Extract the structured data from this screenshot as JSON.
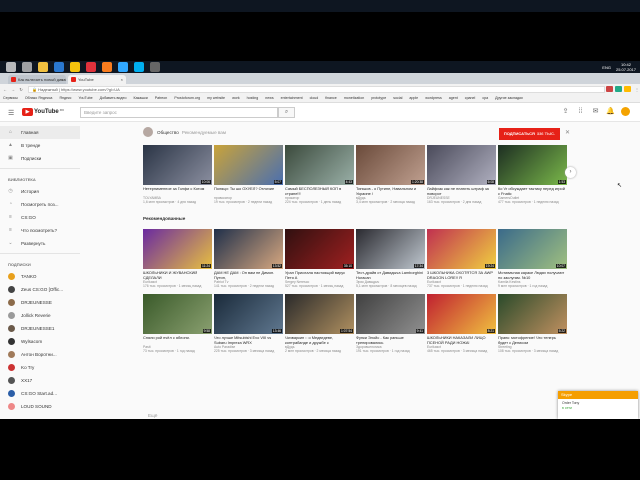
{
  "colors": {
    "accent": "#e62117",
    "skype": "#f59e00",
    "taskbar": "#0e1621"
  },
  "taskbar": {
    "icons": [
      "windows-icon",
      "search-icon",
      "file-explorer-icon",
      "edge-icon",
      "chrome-icon",
      "opera-icon",
      "firefox-icon",
      "photoshop-icon",
      "skype-icon",
      "obs-icon"
    ],
    "lang": "ENG",
    "time": "10:42",
    "date": "25.07.2017"
  },
  "tabs": [
    {
      "label": "Как включить новый дизайн",
      "favicon": "#e62117",
      "active": false
    },
    {
      "label": "YouTube",
      "favicon": "#e62117",
      "active": true
    }
  ],
  "address": {
    "secure": "Надежный",
    "url": "https://www.youtube.com/?gl=UA"
  },
  "bookmarks": [
    "Сервисы",
    "Облако Яндекса",
    "Яндекс",
    "YouTube",
    "Добавить видео",
    "Какашки",
    "Patreon",
    "Prostoforum.org",
    "my website",
    "work",
    "hosting",
    "news",
    "entertainment",
    "cloud",
    "finance",
    "monetization",
    "prototype",
    "social",
    "apple",
    "wordpress",
    "agent",
    "cpanel",
    "cpa",
    "Другие закладки"
  ],
  "header": {
    "logo": "YouTube",
    "region": "RU",
    "search_placeholder": "Введите запрос"
  },
  "sidebar": {
    "main": [
      {
        "label": "Главная",
        "icon": "home-icon"
      },
      {
        "label": "В тренде",
        "icon": "trending-icon"
      },
      {
        "label": "Подписки",
        "icon": "subscriptions-icon"
      }
    ],
    "library_title": "БИБЛИОТЕКА",
    "library": [
      {
        "label": "История",
        "icon": "history-icon"
      },
      {
        "label": "Посмотреть поз...",
        "icon": "clock-icon"
      },
      {
        "label": "CS:GO",
        "icon": "playlist-icon"
      },
      {
        "label": "Что посмотреть?",
        "icon": "playlist-icon"
      },
      {
        "label": "Развернуть",
        "icon": "chevron-down-icon"
      }
    ],
    "subs_title": "ПОДПИСКИ",
    "subs": [
      {
        "label": "TANKO",
        "color": "#e8a01c"
      },
      {
        "label": "Zeus CS:GO [Offic...",
        "color": "#444"
      },
      {
        "label": "DRJEUNESSE",
        "color": "#8c6b4a"
      },
      {
        "label": "Jollick Reverie",
        "color": "#9a9a9a"
      },
      {
        "label": "DRJEUNESSE1",
        "color": "#6b5a4a"
      },
      {
        "label": "Wylsacom",
        "color": "#333"
      },
      {
        "label": "Антон Воротни...",
        "color": "#a07a5a"
      },
      {
        "label": "Ko Try",
        "color": "#c33"
      },
      {
        "label": "XX17",
        "color": "#555"
      },
      {
        "label": "CS:GO Start.ad...",
        "color": "#2b5ea7"
      },
      {
        "label": "LOUD SOUND",
        "color": "#e88"
      }
    ]
  },
  "shelf1": {
    "channel": "Общество",
    "sub": "Рекомендуемые вам",
    "subscribe": "ПОДПИСАТЬСЯ",
    "sub_count": "336 ТЫС."
  },
  "shelf2": {
    "title": "Рекомендованные"
  },
  "shelf3": {
    "title": "Ещё"
  },
  "row1": [
    {
      "title": "Нетерпименное за Голфи с Котом",
      "channel": "TOLYAMBA",
      "meta": "1,6 млн просмотров · 4 дня назад",
      "dur": "10:06",
      "c1": "#2a3445",
      "c2": "#8b8fa0"
    },
    {
      "title": "Поляци: Ты шо ОХУЕЛ? Отличие",
      "channel": "провокатор",
      "meta": "19 тыс. просмотров · 2 недели назад",
      "dur": "5:07",
      "c1": "#c9a33a",
      "c2": "#4a6fb0"
    },
    {
      "title": "Самый БЕСПОЛЕЗНЫЙ КОП в стране!!!",
      "channel": "прокатор",
      "meta": "224 тыс. просмотров · 1 день назад",
      "dur": "4:43",
      "c1": "#3b4a3c",
      "c2": "#9ab0a8"
    },
    {
      "title": "Тиньков - о Путине, Навальном и Украине /",
      "channel": "вДудь",
      "meta": "3,4 млн просмотров · 2 месяца назад",
      "dur": "1:20:38",
      "c1": "#6a4a3a",
      "c2": "#c0a090"
    },
    {
      "title": "Лайфхак как не платить штраф за поворот",
      "channel": "DRJEUNESSE",
      "meta": "163 тыс. просмотров · 2 дня назад",
      "dur": "6:08",
      "c1": "#4a4a5a",
      "c2": "#b0b0c0"
    },
    {
      "title": "Ко Vr обсуждает тактику перед игрой с Fnatic",
      "channel": "GamersOutlet",
      "meta": "477 тыс. просмотров · 1 неделю назад",
      "dur": "1:53",
      "c1": "#1d2e22",
      "c2": "#7ab84a"
    }
  ],
  "row2": [
    {
      "title": "ШКОЛЬНИКИ И ЖУВАНСКИЙ СДЕЛАЛИ",
      "channel": "Eurikasxt",
      "meta": "176 тыс. просмотров · 1 месяц назад",
      "dur": "11:24",
      "c1": "#6a2aa0",
      "c2": "#e8c040"
    },
    {
      "title": "ДАМ НЕ ДАМ : Он вам не Димон. Путин,",
      "channel": "Patriot Tv",
      "meta": "141 тыс. просмотров · 2 недели назад",
      "dur": "13:52",
      "c1": "#20304a",
      "c2": "#d8a880"
    },
    {
      "title": "Урал Прислала настоящий вирус Петя А",
      "channel": "Sergey Neresco",
      "meta": "527 тыс. просмотров · 1 месяц назад",
      "dur": "35:10",
      "c1": "#301010",
      "c2": "#a02020"
    },
    {
      "title": "Тест-драйв от Давидыча Lamborghini Huracan",
      "channel": "Эрик Давыдыч",
      "meta": "5,1 млн просмотров · 8 месяцев назад",
      "dur": "17:34",
      "c1": "#2a2a30",
      "c2": "#c0c8d0"
    },
    {
      "title": "3 ШКОЛЬНИКА ОХОТЯТСЯ ЗА AWP DRAGON LORE!! Я",
      "channel": "Eurikasxt",
      "meta": "737 тыс. просмотров · 1 неделю назад",
      "dur": "19:24",
      "c1": "#c03050",
      "c2": "#f0d040"
    },
    {
      "title": "Мотивачная караке Людях получают по заслугам. №10",
      "channel": "Kamila Kestins",
      "meta": "9 млн просмотров · 1 год назад",
      "dur": "10:07",
      "c1": "#3a6a8a",
      "c2": "#a0c080"
    }
  ],
  "row3": [
    {
      "title": "Сняли рой пчёл с яблони.",
      "channel": "Pasit",
      "meta": "73 тыс. просмотров · 1 год назад",
      "dur": "9:58",
      "c1": "#3a5a2a",
      "c2": "#8aa070"
    },
    {
      "title": "Что лучше Mitsubishi Evo VIII vs Subaru Impreza WRX",
      "channel": "Auto Paradise",
      "meta": "225 тыс. просмотров · 3 месяца назад",
      "dur": "13:46",
      "c1": "#1a2a3a",
      "c2": "#607890"
    },
    {
      "title": "Чичваркин :: о Медведеве, контрабанде и дружбе с",
      "channel": "вДудь",
      "meta": "2 млн просмотров · 2 месяца назад",
      "dur": "1:07:54",
      "c1": "#2a2a2a",
      "c2": "#b09060"
    },
    {
      "title": "Функи Элойс - Как раньше тренировались",
      "channel": "Здоровьелогика",
      "meta": "191 тыс. просмотров · 1 год назад",
      "dur": "9:41",
      "c1": "#404040",
      "c2": "#909090"
    },
    {
      "title": "ШКОЛЬНИКИ НАКАЗАЛИ ЛИЦО ПСЕНОЙ РАДИ НОЖА!",
      "channel": "Eurikasxt",
      "meta": "465 тыс. просмотров · 3 месяца назад",
      "dur": "8:21",
      "c1": "#c02030",
      "c2": "#f0c040"
    },
    {
      "title": "Пранк: мотофрение! Что теперь будет с Денисом",
      "channel": "Streeting",
      "meta": "108 тыс. просмотров · 3 месяца назад",
      "dur": "5:22",
      "c1": "#2a4a2a",
      "c2": "#c09060"
    }
  ],
  "skype": {
    "title": "Skype",
    "line1": "Order Tony",
    "line2": "в сети"
  }
}
